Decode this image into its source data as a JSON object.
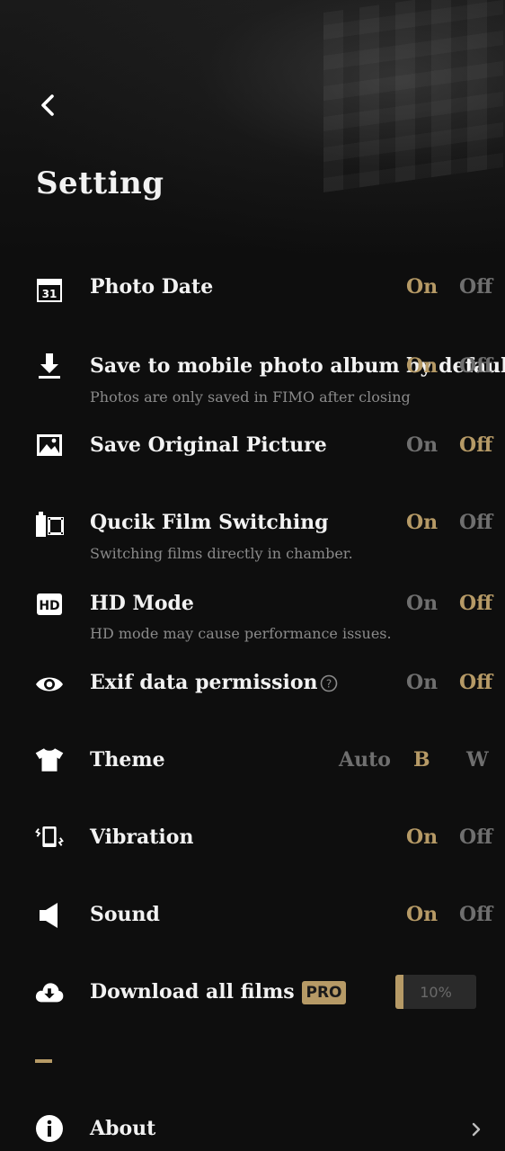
{
  "header": {
    "title": "Setting"
  },
  "settings": {
    "photo_date": {
      "label": "Photo Date",
      "on": "On",
      "off": "Off",
      "selected": "On"
    },
    "save_album": {
      "label": "Save to mobile photo album by default",
      "sub": "Photos are only saved in FIMO after closing",
      "on": "On",
      "off": "Off",
      "selected": "On"
    },
    "save_original": {
      "label": "Save Original Picture",
      "on": "On",
      "off": "Off",
      "selected": "Off"
    },
    "film_switch": {
      "label": "Qucik Film Switching",
      "sub": "Switching films directly in chamber.",
      "on": "On",
      "off": "Off",
      "selected": "On"
    },
    "hd_mode": {
      "label": "HD Mode",
      "sub": "HD mode may cause performance issues.",
      "on": "On",
      "off": "Off",
      "selected": "Off"
    },
    "exif": {
      "label": "Exif data permission",
      "on": "On",
      "off": "Off",
      "selected": "Off"
    },
    "theme": {
      "label": "Theme",
      "auto": "Auto",
      "b": "B",
      "w": "W",
      "selected": "B"
    },
    "vibration": {
      "label": "Vibration",
      "on": "On",
      "off": "Off",
      "selected": "On"
    },
    "sound": {
      "label": "Sound",
      "on": "On",
      "off": "Off",
      "selected": "On"
    },
    "download": {
      "label": "Download all films",
      "badge": "PRO",
      "progress_text": "10%",
      "progress": 0.1
    },
    "about": {
      "label": "About"
    }
  },
  "icons": {
    "back": "chevron-left-icon",
    "calendar_day": "31"
  },
  "colors": {
    "accent": "#b69a66",
    "dim": "#6f6f6f",
    "background": "#0e0e0e"
  }
}
